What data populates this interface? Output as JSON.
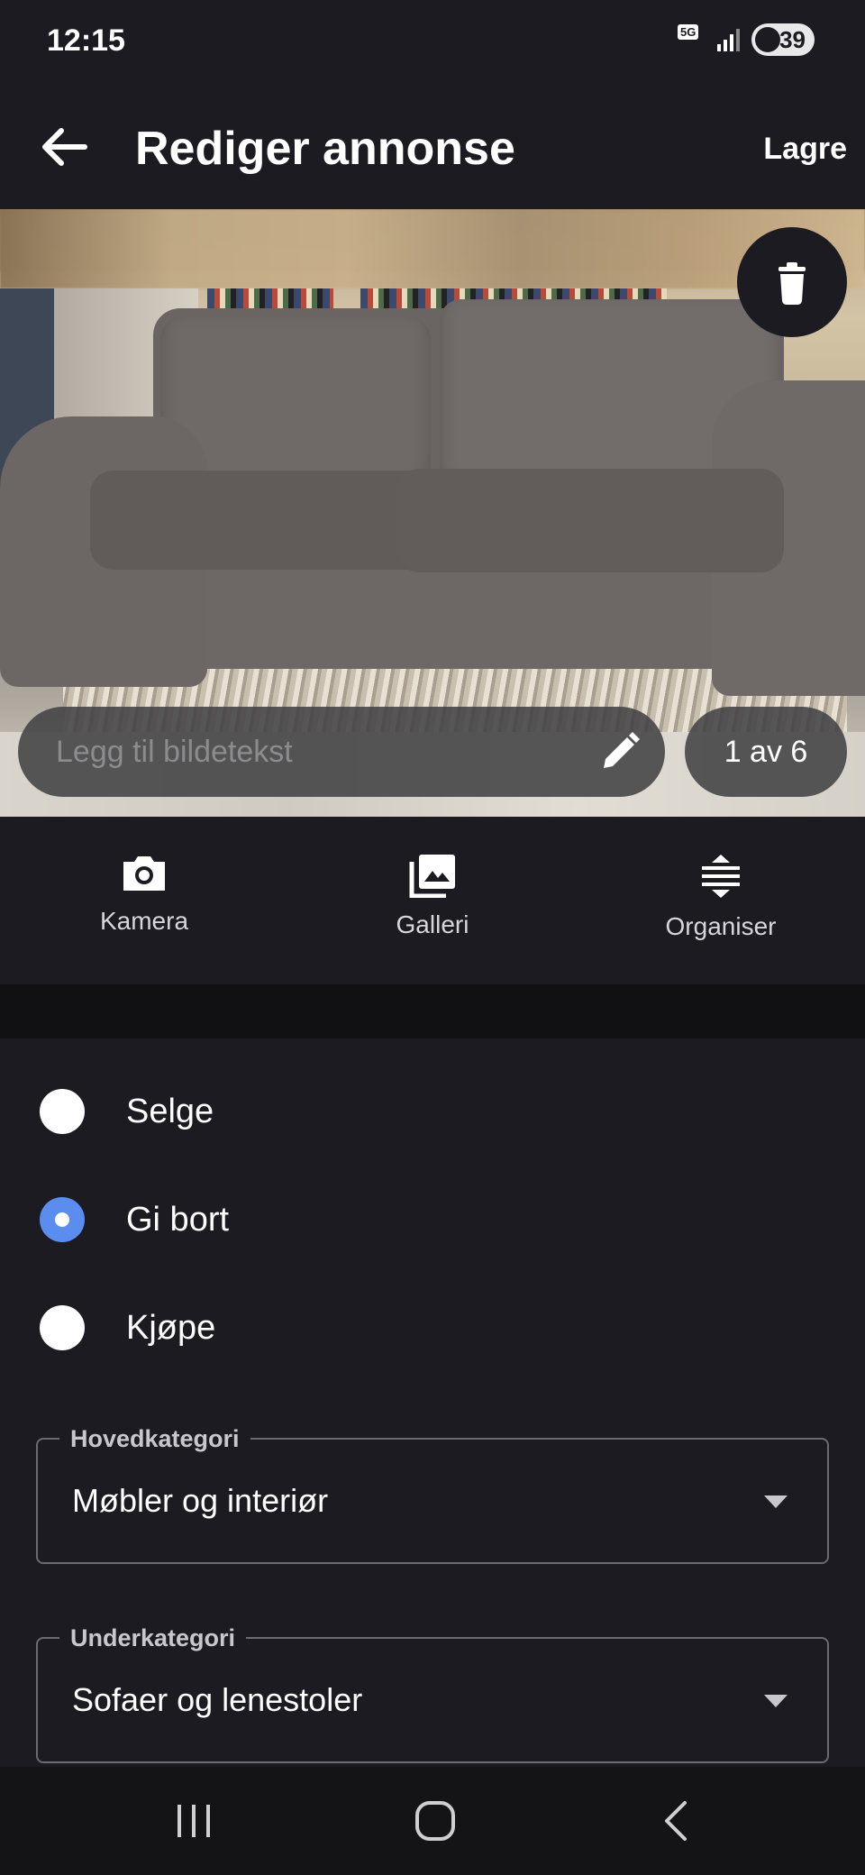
{
  "status_bar": {
    "time": "12:15",
    "network": "5G",
    "battery": "39"
  },
  "app_bar": {
    "back_icon": "arrow-left-icon",
    "title": "Rediger annonse",
    "save_label": "Lagre"
  },
  "image_viewer": {
    "delete_icon": "trash-icon",
    "caption_placeholder": "Legg til bildetekst",
    "edit_icon": "pencil-icon",
    "counter": "1 av 6"
  },
  "image_actions": [
    {
      "icon": "camera-icon",
      "label": "Kamera"
    },
    {
      "icon": "gallery-icon",
      "label": "Galleri"
    },
    {
      "icon": "reorder-icon",
      "label": "Organiser"
    }
  ],
  "ad_type": {
    "options": [
      {
        "label": "Selge",
        "selected": false
      },
      {
        "label": "Gi bort",
        "selected": true
      },
      {
        "label": "Kjøpe",
        "selected": false
      }
    ]
  },
  "main_category": {
    "label": "Hovedkategori",
    "value": "Møbler og interiør"
  },
  "sub_category": {
    "label": "Underkategori",
    "value": "Sofaer og lenestoler"
  },
  "colors": {
    "background": "#1c1b21",
    "accent": "#5b8def"
  }
}
